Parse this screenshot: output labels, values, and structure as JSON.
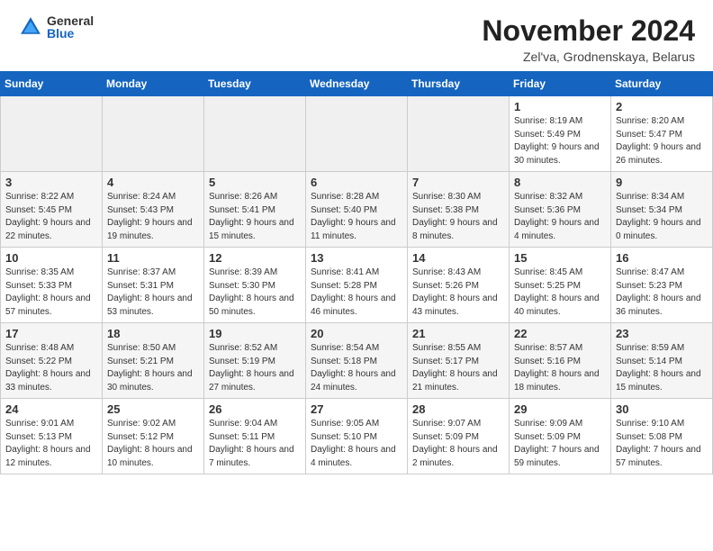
{
  "header": {
    "logo_general": "General",
    "logo_blue": "Blue",
    "month_title": "November 2024",
    "location": "Zel'va, Grodnenskaya, Belarus"
  },
  "days_of_week": [
    "Sunday",
    "Monday",
    "Tuesday",
    "Wednesday",
    "Thursday",
    "Friday",
    "Saturday"
  ],
  "weeks": [
    [
      {
        "day": "",
        "detail": ""
      },
      {
        "day": "",
        "detail": ""
      },
      {
        "day": "",
        "detail": ""
      },
      {
        "day": "",
        "detail": ""
      },
      {
        "day": "",
        "detail": ""
      },
      {
        "day": "1",
        "detail": "Sunrise: 8:19 AM\nSunset: 5:49 PM\nDaylight: 9 hours and 30 minutes."
      },
      {
        "day": "2",
        "detail": "Sunrise: 8:20 AM\nSunset: 5:47 PM\nDaylight: 9 hours and 26 minutes."
      }
    ],
    [
      {
        "day": "3",
        "detail": "Sunrise: 8:22 AM\nSunset: 5:45 PM\nDaylight: 9 hours and 22 minutes."
      },
      {
        "day": "4",
        "detail": "Sunrise: 8:24 AM\nSunset: 5:43 PM\nDaylight: 9 hours and 19 minutes."
      },
      {
        "day": "5",
        "detail": "Sunrise: 8:26 AM\nSunset: 5:41 PM\nDaylight: 9 hours and 15 minutes."
      },
      {
        "day": "6",
        "detail": "Sunrise: 8:28 AM\nSunset: 5:40 PM\nDaylight: 9 hours and 11 minutes."
      },
      {
        "day": "7",
        "detail": "Sunrise: 8:30 AM\nSunset: 5:38 PM\nDaylight: 9 hours and 8 minutes."
      },
      {
        "day": "8",
        "detail": "Sunrise: 8:32 AM\nSunset: 5:36 PM\nDaylight: 9 hours and 4 minutes."
      },
      {
        "day": "9",
        "detail": "Sunrise: 8:34 AM\nSunset: 5:34 PM\nDaylight: 9 hours and 0 minutes."
      }
    ],
    [
      {
        "day": "10",
        "detail": "Sunrise: 8:35 AM\nSunset: 5:33 PM\nDaylight: 8 hours and 57 minutes."
      },
      {
        "day": "11",
        "detail": "Sunrise: 8:37 AM\nSunset: 5:31 PM\nDaylight: 8 hours and 53 minutes."
      },
      {
        "day": "12",
        "detail": "Sunrise: 8:39 AM\nSunset: 5:30 PM\nDaylight: 8 hours and 50 minutes."
      },
      {
        "day": "13",
        "detail": "Sunrise: 8:41 AM\nSunset: 5:28 PM\nDaylight: 8 hours and 46 minutes."
      },
      {
        "day": "14",
        "detail": "Sunrise: 8:43 AM\nSunset: 5:26 PM\nDaylight: 8 hours and 43 minutes."
      },
      {
        "day": "15",
        "detail": "Sunrise: 8:45 AM\nSunset: 5:25 PM\nDaylight: 8 hours and 40 minutes."
      },
      {
        "day": "16",
        "detail": "Sunrise: 8:47 AM\nSunset: 5:23 PM\nDaylight: 8 hours and 36 minutes."
      }
    ],
    [
      {
        "day": "17",
        "detail": "Sunrise: 8:48 AM\nSunset: 5:22 PM\nDaylight: 8 hours and 33 minutes."
      },
      {
        "day": "18",
        "detail": "Sunrise: 8:50 AM\nSunset: 5:21 PM\nDaylight: 8 hours and 30 minutes."
      },
      {
        "day": "19",
        "detail": "Sunrise: 8:52 AM\nSunset: 5:19 PM\nDaylight: 8 hours and 27 minutes."
      },
      {
        "day": "20",
        "detail": "Sunrise: 8:54 AM\nSunset: 5:18 PM\nDaylight: 8 hours and 24 minutes."
      },
      {
        "day": "21",
        "detail": "Sunrise: 8:55 AM\nSunset: 5:17 PM\nDaylight: 8 hours and 21 minutes."
      },
      {
        "day": "22",
        "detail": "Sunrise: 8:57 AM\nSunset: 5:16 PM\nDaylight: 8 hours and 18 minutes."
      },
      {
        "day": "23",
        "detail": "Sunrise: 8:59 AM\nSunset: 5:14 PM\nDaylight: 8 hours and 15 minutes."
      }
    ],
    [
      {
        "day": "24",
        "detail": "Sunrise: 9:01 AM\nSunset: 5:13 PM\nDaylight: 8 hours and 12 minutes."
      },
      {
        "day": "25",
        "detail": "Sunrise: 9:02 AM\nSunset: 5:12 PM\nDaylight: 8 hours and 10 minutes."
      },
      {
        "day": "26",
        "detail": "Sunrise: 9:04 AM\nSunset: 5:11 PM\nDaylight: 8 hours and 7 minutes."
      },
      {
        "day": "27",
        "detail": "Sunrise: 9:05 AM\nSunset: 5:10 PM\nDaylight: 8 hours and 4 minutes."
      },
      {
        "day": "28",
        "detail": "Sunrise: 9:07 AM\nSunset: 5:09 PM\nDaylight: 8 hours and 2 minutes."
      },
      {
        "day": "29",
        "detail": "Sunrise: 9:09 AM\nSunset: 5:09 PM\nDaylight: 7 hours and 59 minutes."
      },
      {
        "day": "30",
        "detail": "Sunrise: 9:10 AM\nSunset: 5:08 PM\nDaylight: 7 hours and 57 minutes."
      }
    ]
  ]
}
